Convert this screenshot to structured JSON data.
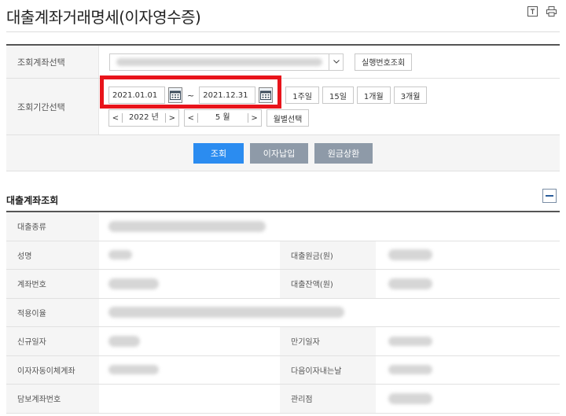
{
  "page": {
    "title": "대출계좌거래명세(이자영수증)"
  },
  "search": {
    "account_label": "조회계좌선택",
    "serial_button": "실행번호조회",
    "period_label": "조회기간선택",
    "start_date": "2021.01.01",
    "end_date": "2021.12.31",
    "tilde": "~",
    "quick": [
      "1주일",
      "15일",
      "1개월",
      "3개월"
    ],
    "year_value": "2022 년",
    "month_value": "5 월",
    "monthly_button": "월별선택"
  },
  "actions": {
    "search": "조회",
    "interest_pay": "이자납입",
    "principal_repay": "원금상환"
  },
  "section": {
    "title": "대출계좌조회"
  },
  "detail": {
    "loan_type": "대출종류",
    "name": "성명",
    "principal": "대출원금(원)",
    "account_no": "계좌번호",
    "balance": "대출잔액(원)",
    "rate": "적용이율",
    "open_date": "신규일자",
    "maturity": "만기일자",
    "auto_transfer": "이자자동이체계좌",
    "next_date": "다음이자내는날",
    "collateral": "담보계좌번호",
    "branch": "관리점"
  }
}
